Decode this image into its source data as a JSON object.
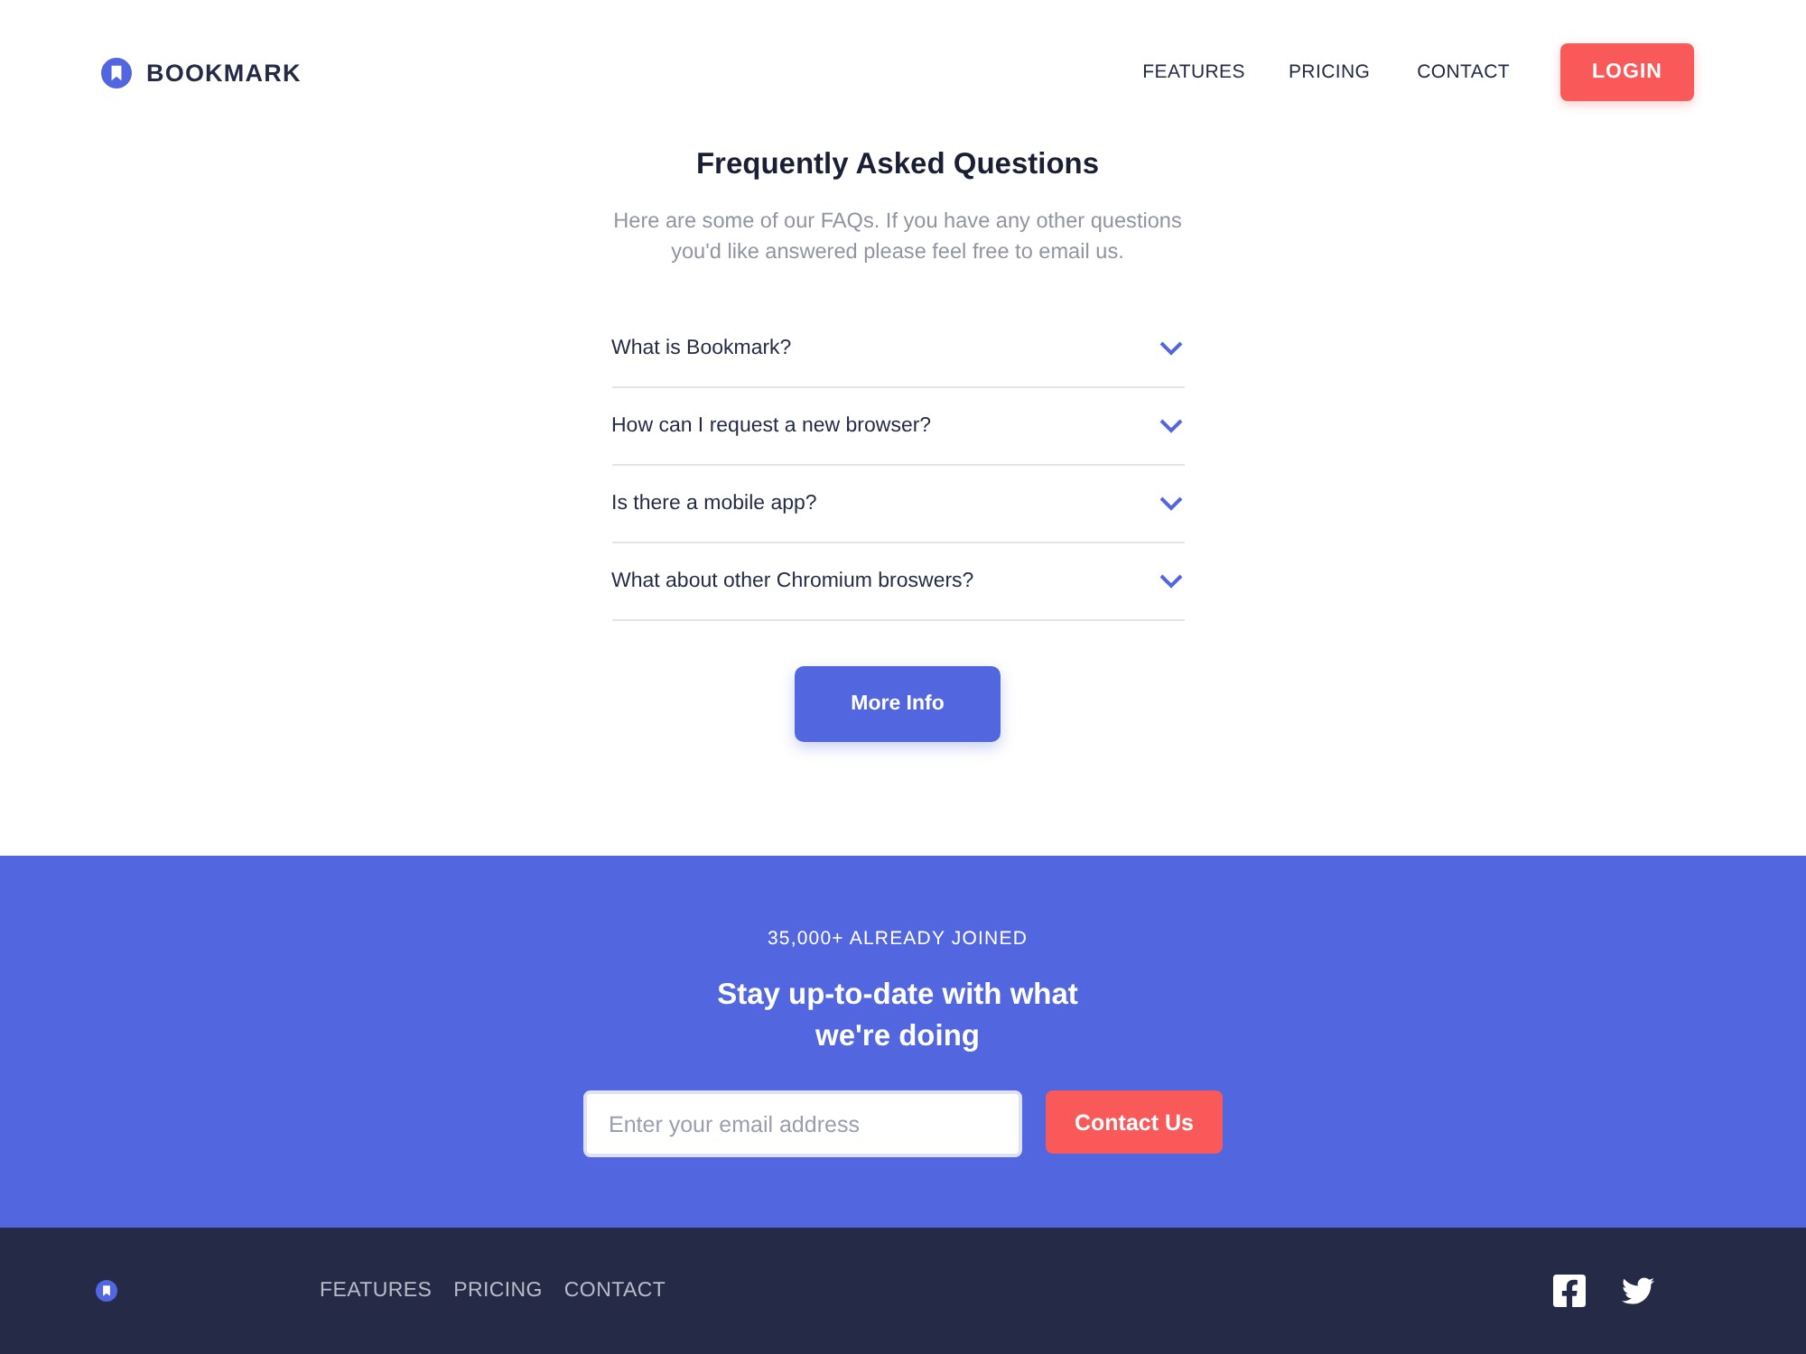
{
  "header": {
    "logo": {
      "text": "BOOKMARK"
    },
    "nav": [
      "FEATURES",
      "PRICING",
      "CONTACT"
    ],
    "login_button": "LOGIN"
  },
  "faq": {
    "title": "Frequently Asked Questions",
    "subtitle": "Here are some of our FAQs. If you have any other questions you'd like answered please feel free to email us.",
    "questions": [
      {
        "question": "What is Bookmark?",
        "expanded": false
      },
      {
        "question": "How can I request a new browser?",
        "expanded": false
      },
      {
        "question": "Is there a mobile app?",
        "expanded": false
      },
      {
        "question": "What about other Chromium broswers?",
        "expanded": false
      }
    ],
    "button": "More Info"
  },
  "signup": {
    "counter": "35,000+ ALREADY JOINED",
    "heading": "Stay up-to-date with what we're doing",
    "email": {
      "placeholder": "Enter your email address"
    },
    "button": "Contact Us"
  },
  "footer": {
    "nav": [
      "FEATURES",
      "PRICING",
      "CONTACT"
    ],
    "social": [
      {
        "kind": "facebook"
      },
      {
        "kind": "twitter"
      }
    ]
  }
}
